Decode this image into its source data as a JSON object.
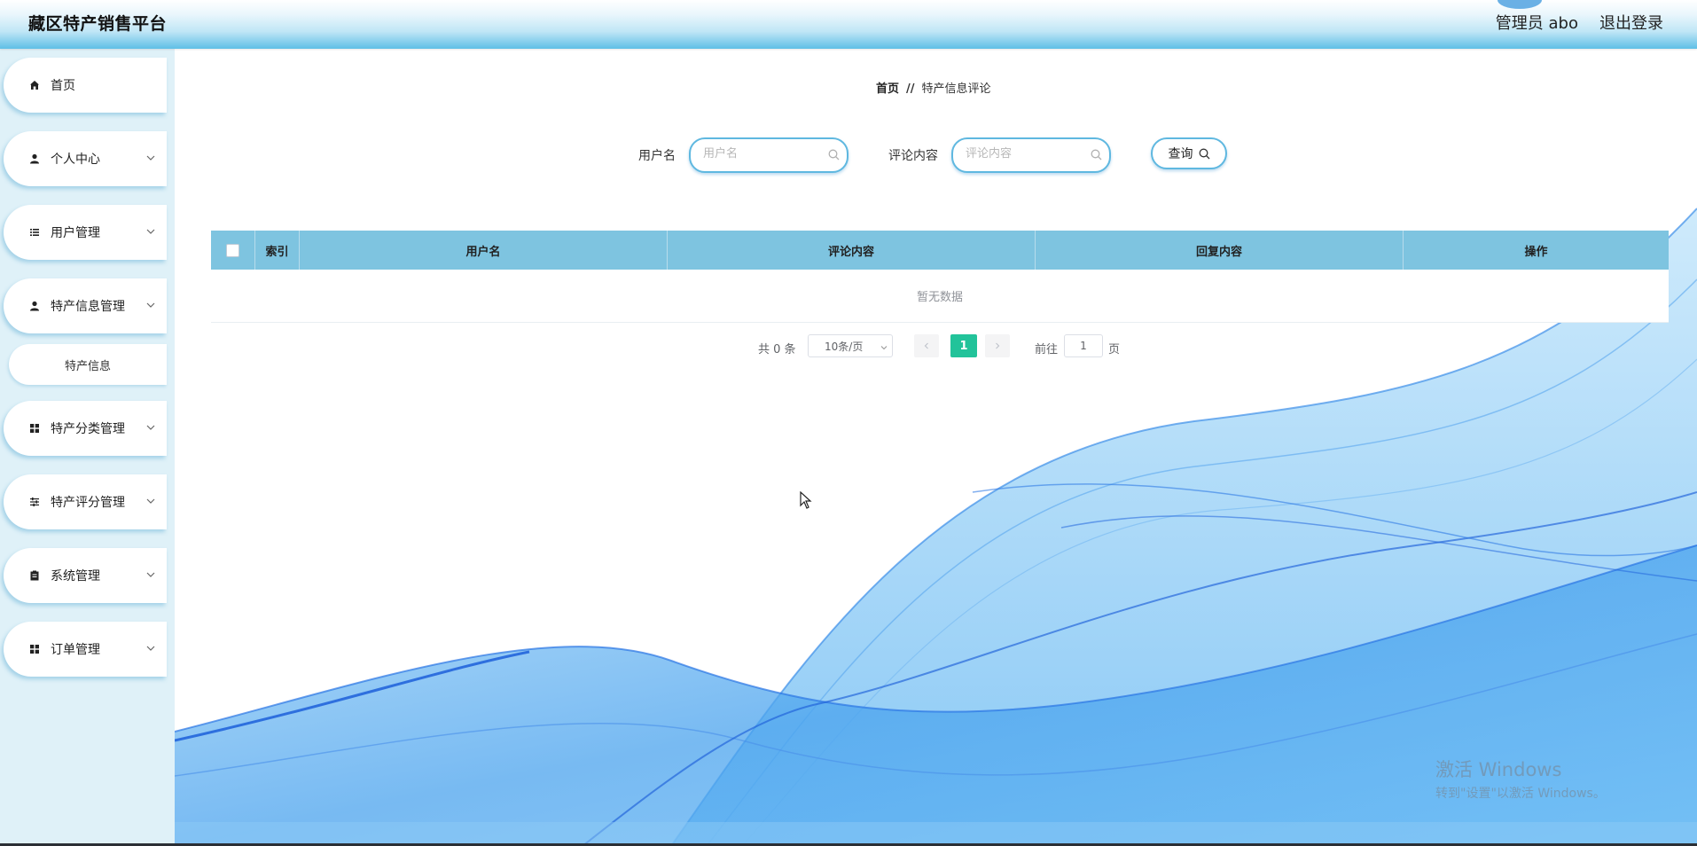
{
  "header": {
    "title": "藏区特产销售平台",
    "admin_label": "管理员 abo",
    "logout_label": "退出登录"
  },
  "sidebar": {
    "items": [
      {
        "label": "首页",
        "icon": "home-icon"
      },
      {
        "label": "个人中心",
        "icon": "user-icon"
      },
      {
        "label": "用户管理",
        "icon": "list-icon"
      },
      {
        "label": "特产信息管理",
        "icon": "user-icon"
      },
      {
        "label": "特产分类管理",
        "icon": "grid-icon"
      },
      {
        "label": "特产评分管理",
        "icon": "sliders-icon"
      },
      {
        "label": "系统管理",
        "icon": "clipboard-icon"
      },
      {
        "label": "订单管理",
        "icon": "grid-icon"
      }
    ],
    "sub_item": "特产信息"
  },
  "breadcrumb": {
    "home": "首页",
    "separator": "//",
    "current": "特产信息评论"
  },
  "search": {
    "username_label": "用户名",
    "username_placeholder": "用户名",
    "comment_label": "评论内容",
    "comment_placeholder": "评论内容",
    "query_label": "查询"
  },
  "table": {
    "columns": [
      "索引",
      "用户名",
      "评论内容",
      "回复内容",
      "操作"
    ],
    "rows": [],
    "empty_text": "暂无数据"
  },
  "pagination": {
    "total": "共 0 条",
    "page_size": "10条/页",
    "current_page": "1",
    "goto_label": "前往",
    "goto_value": "1",
    "page_suffix": "页"
  },
  "watermark": {
    "line1": "激活 Windows",
    "line2": "转到\"设置\"以激活 Windows。"
  },
  "colors": {
    "header_gradient_end": "#5fbfe6",
    "sidebar_bg": "#dff1f8",
    "table_header": "#7ec4e0",
    "active_page": "#22c39a",
    "wave": "#3d8fe8"
  }
}
